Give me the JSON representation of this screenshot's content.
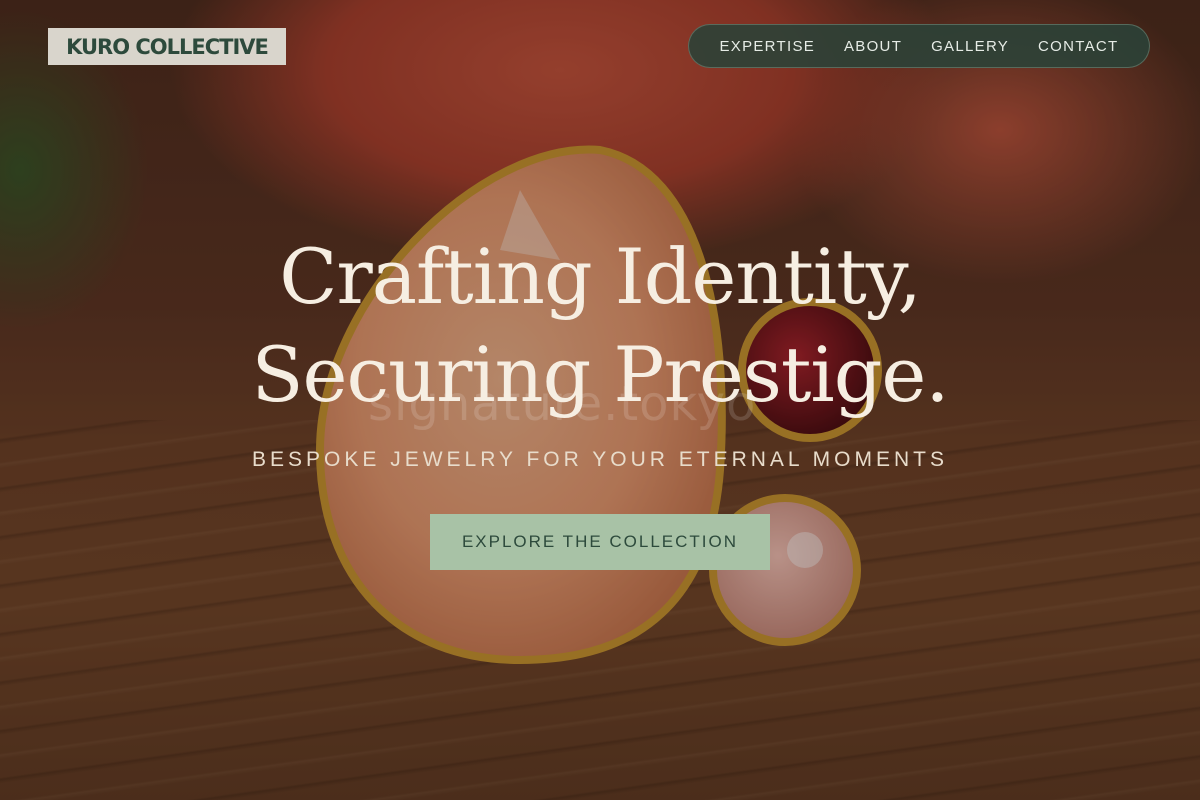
{
  "brand": {
    "logo_text": "KURO COLLECTIVE"
  },
  "nav": {
    "items": [
      {
        "label": "EXPERTISE"
      },
      {
        "label": "ABOUT"
      },
      {
        "label": "GALLERY"
      },
      {
        "label": "CONTACT"
      }
    ]
  },
  "hero": {
    "headline_line1": "Crafting Identity,",
    "headline_line2": "Securing Prestige.",
    "subtitle": "BESPOKE JEWELRY FOR YOUR ETERNAL MOMENTS",
    "cta_label": "EXPLORE THE COLLECTION",
    "watermark_text": "signature.tokyo"
  },
  "colors": {
    "brand_green": "#2d4a3c",
    "nav_bg": "#2a4238",
    "cta_bg": "#a8c2a6",
    "headline": "#f6eee2"
  }
}
